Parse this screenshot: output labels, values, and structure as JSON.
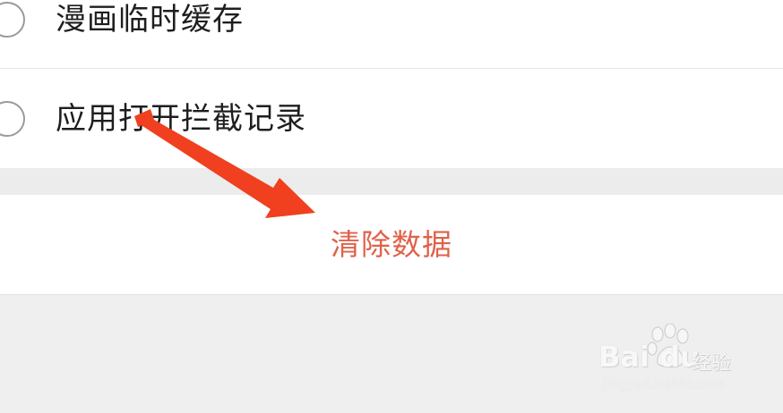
{
  "options": [
    {
      "label": "漫画临时缓存",
      "checked": false
    },
    {
      "label": "应用打开拦截记录",
      "checked": false
    }
  ],
  "clear_button": {
    "label": "清除数据",
    "color": "#e0614a"
  },
  "annotation": {
    "type": "arrow",
    "color": "#f0401f",
    "points_to": "clear-data-button"
  },
  "watermark": {
    "logo_text": "Bai du",
    "cn_text": "经验",
    "url": "jingyan.baidu.com"
  }
}
